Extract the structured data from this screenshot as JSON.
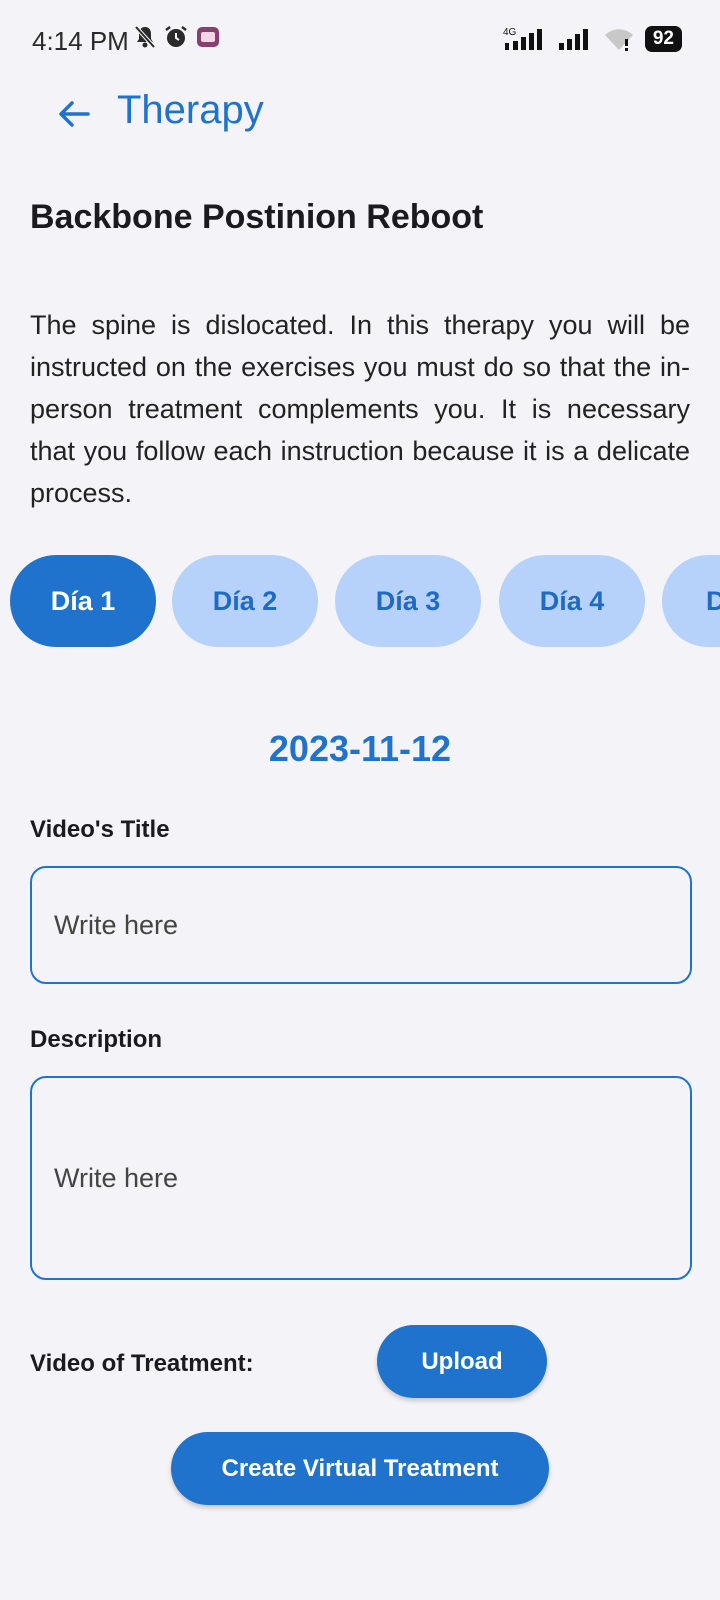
{
  "status_bar": {
    "time": "4:14 PM",
    "network_type": "4G",
    "battery": "92",
    "icons": [
      "bell-off-icon",
      "alarm-icon",
      "app-notification-icon",
      "signal-icon",
      "signal-icon",
      "wifi-icon"
    ]
  },
  "header": {
    "title": "Therapy",
    "back_icon": "arrow-left-icon"
  },
  "therapy": {
    "name": "Backbone Postinion Reboot",
    "description": "The spine is dislocated. In this therapy you will be instructed on the exercises you must do so that the in-person treatment complements you. It is necessary that you follow each instruction because it is a delicate process."
  },
  "days": [
    {
      "label": "Día 1",
      "active": true
    },
    {
      "label": "Día 2",
      "active": false
    },
    {
      "label": "Día 3",
      "active": false
    },
    {
      "label": "Día 4",
      "active": false
    },
    {
      "label": "D",
      "active": false
    }
  ],
  "date": "2023-11-12",
  "form": {
    "video_title_label": "Video's Title",
    "video_title_placeholder": "Write here",
    "description_label": "Description",
    "description_placeholder": "Write here",
    "video_label": "Video of Treatment:",
    "upload_label": "Upload",
    "create_label": "Create Virtual Treatment"
  },
  "colors": {
    "accent": "#1f73cc",
    "chip_inactive": "#b6d2fb",
    "background": "#f4f4f8"
  }
}
